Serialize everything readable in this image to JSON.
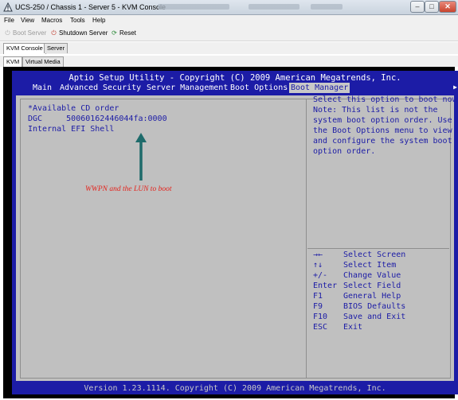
{
  "window": {
    "title": "UCS-250 / Chassis 1 - Server 5 - KVM Console",
    "buttons": {
      "minimize": "–",
      "maximize": "□",
      "close": "✕"
    }
  },
  "menubar": {
    "items": [
      "File",
      "View",
      "Macros",
      "Tools",
      "Help"
    ]
  },
  "toolbar": {
    "boot_server": "Boot Server",
    "shutdown_server": "Shutdown Server",
    "reset": "Reset"
  },
  "tabs_top": {
    "items": [
      "KVM Console",
      "Server"
    ],
    "active": "KVM Console"
  },
  "tabs_sub": {
    "items": [
      "KVM",
      "Virtual Media"
    ],
    "active": "KVM"
  },
  "bios": {
    "title": "Aptio Setup Utility - Copyright (C) 2009 American Megatrends, Inc.",
    "tabs": [
      "Main",
      "Advanced",
      "Security",
      "Server Management",
      "Boot Options",
      "Boot Manager"
    ],
    "active_tab": "Boot Manager",
    "boot_list": [
      "*Available CD order",
      "DGC     50060162446044fa:0000",
      "Internal EFI Shell"
    ],
    "help_text": [
      "Select this option to boot now.",
      "Note: This list is not the",
      "system boot option order. Use",
      "the Boot Options menu to view",
      "and configure the system boot",
      "option order."
    ],
    "keys": [
      {
        "key": "→←",
        "desc": "Select Screen"
      },
      {
        "key": "↑↓",
        "desc": "Select Item"
      },
      {
        "key": "+/-",
        "desc": "Change Value"
      },
      {
        "key": "Enter",
        "desc": "Select Field"
      },
      {
        "key": "F1",
        "desc": "General Help"
      },
      {
        "key": "F9",
        "desc": "BIOS Defaults"
      },
      {
        "key": "F10",
        "desc": "Save and Exit"
      },
      {
        "key": "ESC",
        "desc": "Exit"
      }
    ],
    "footer": "Version 1.23.1114. Copyright (C) 2009 American Megatrends, Inc."
  },
  "annotation": {
    "text": "WWPN and the LUN to boot",
    "color": "#e4231c"
  },
  "colors": {
    "bios_blue": "#1c1ca6",
    "bios_panel": "#c0c0c0",
    "arrow": "#1e6b6b"
  }
}
